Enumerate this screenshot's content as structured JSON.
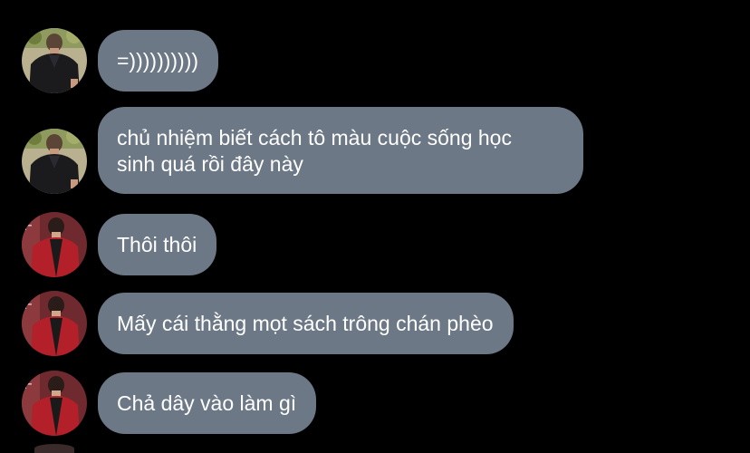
{
  "colors": {
    "background": "#000000",
    "bubble": "#6c7885",
    "bubble_text": "#ffffff"
  },
  "messages": [
    {
      "sender_avatar": "avatar-dark-jacket",
      "text": "=))))))))))"
    },
    {
      "sender_avatar": "avatar-dark-jacket",
      "text": "chủ nhiệm biết cách tô màu cuộc sống học\nsinh quá rồi đây này"
    },
    {
      "sender_avatar": "avatar-red-jacket",
      "text": "Thôi thôi"
    },
    {
      "sender_avatar": "avatar-red-jacket",
      "text": "Mấy cái thằng mọt sách trông chán phèo"
    },
    {
      "sender_avatar": "avatar-red-jacket",
      "text": "Chả dây vào làm gì"
    }
  ]
}
